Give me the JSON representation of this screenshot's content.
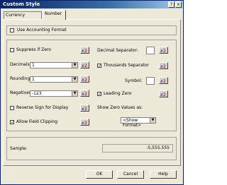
{
  "window": {
    "title": "Custom Style",
    "help_glyph": "?",
    "close_glyph": "×"
  },
  "tabs": [
    {
      "label": "Currency Symbol"
    },
    {
      "label": "Number"
    }
  ],
  "use_accounting_format": {
    "label": "Use Accounting Format",
    "checked": false
  },
  "left": {
    "suppress_zero": {
      "label": "Suppress if Zero",
      "checked": false
    },
    "decimals": {
      "label": "Decimals:",
      "value": "1"
    },
    "rounding": {
      "label": "Rounding:",
      "value": "1"
    },
    "negatives": {
      "label": "Negatives:",
      "value": "-123"
    },
    "reverse_sign": {
      "label": "Reverse Sign for Display",
      "checked": false
    },
    "allow_field_clipping": {
      "label": "Allow Field Clipping",
      "checked": true,
      "mark": "✓"
    }
  },
  "right": {
    "decimal_separator": {
      "label": "Decimal Separator:"
    },
    "thousands_separator": {
      "label": "Thousands Separator",
      "checked": true,
      "mark": "✓"
    },
    "symbol": {
      "label": "Symbol:"
    },
    "leading_zero": {
      "label": "Leading Zero",
      "checked": true,
      "mark": "✓"
    },
    "show_zero_values_as": {
      "label": "Show Zero Values as:",
      "value": "<Show Format>"
    }
  },
  "sample": {
    "label": "Sample:",
    "value": "-5,555.555"
  },
  "buttons": {
    "ok": "OK",
    "cancel": "Cancel",
    "help": "Help"
  }
}
